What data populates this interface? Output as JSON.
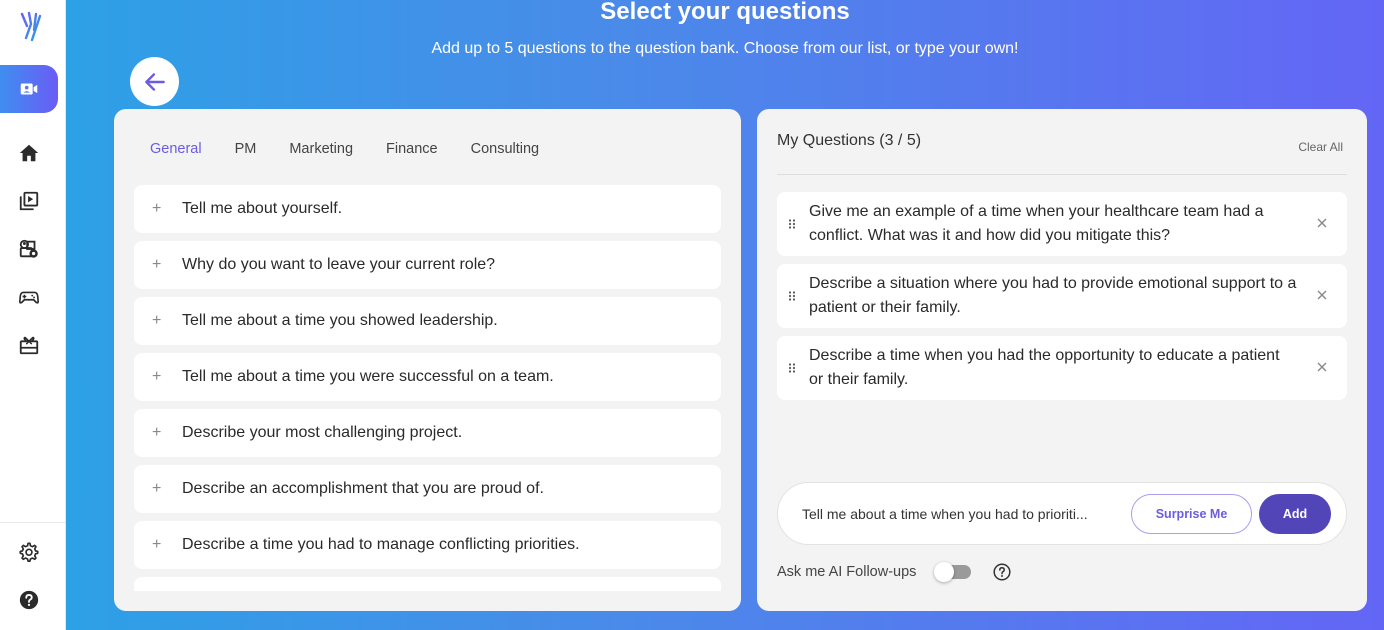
{
  "header": {
    "title": "Select your questions",
    "subtitle": "Add up to 5 questions to the question bank. Choose from our list, or type your own!"
  },
  "sidebar": {
    "items": [
      {
        "icon": "video-interview-icon",
        "active": true
      },
      {
        "icon": "home-icon",
        "active": false
      },
      {
        "icon": "video-library-icon",
        "active": false
      },
      {
        "icon": "people-icon",
        "active": false
      },
      {
        "icon": "gamepad-icon",
        "active": false
      },
      {
        "icon": "gift-icon",
        "active": false
      }
    ],
    "bottom_items": [
      {
        "icon": "settings-icon"
      },
      {
        "icon": "help-icon"
      }
    ]
  },
  "question_bank": {
    "tabs": [
      {
        "label": "General",
        "active": true
      },
      {
        "label": "PM",
        "active": false
      },
      {
        "label": "Marketing",
        "active": false
      },
      {
        "label": "Finance",
        "active": false
      },
      {
        "label": "Consulting",
        "active": false
      }
    ],
    "add_symbol": "+",
    "questions": [
      "Tell me about yourself.",
      "Why do you want to leave your current role?",
      "Tell me about a time you showed leadership.",
      "Tell me about a time you were successful on a team.",
      "Describe your most challenging project.",
      "Describe an accomplishment that you are proud of.",
      "Describe a time you had to manage conflicting priorities.",
      ""
    ]
  },
  "my_questions": {
    "title": "My Questions (3 / 5)",
    "clear_all_label": "Clear All",
    "selected": [
      "Give me an example of a time when your healthcare team had a conflict. What was it and how did you mitigate this?",
      "Describe a situation where you had to provide emotional support to a patient or their family.",
      "Describe a time when you had the opportunity to educate a patient or their family."
    ],
    "input_value": "Tell me about a time when you had to prioriti...",
    "surprise_label": "Surprise Me",
    "add_label": "Add",
    "followups_label": "Ask me AI Follow-ups",
    "followups_enabled": false
  },
  "colors": {
    "accent": "#6b5ce0",
    "add_button": "#5245b8",
    "gradient_start": "#2aa3e6",
    "gradient_end": "#6366f5"
  }
}
